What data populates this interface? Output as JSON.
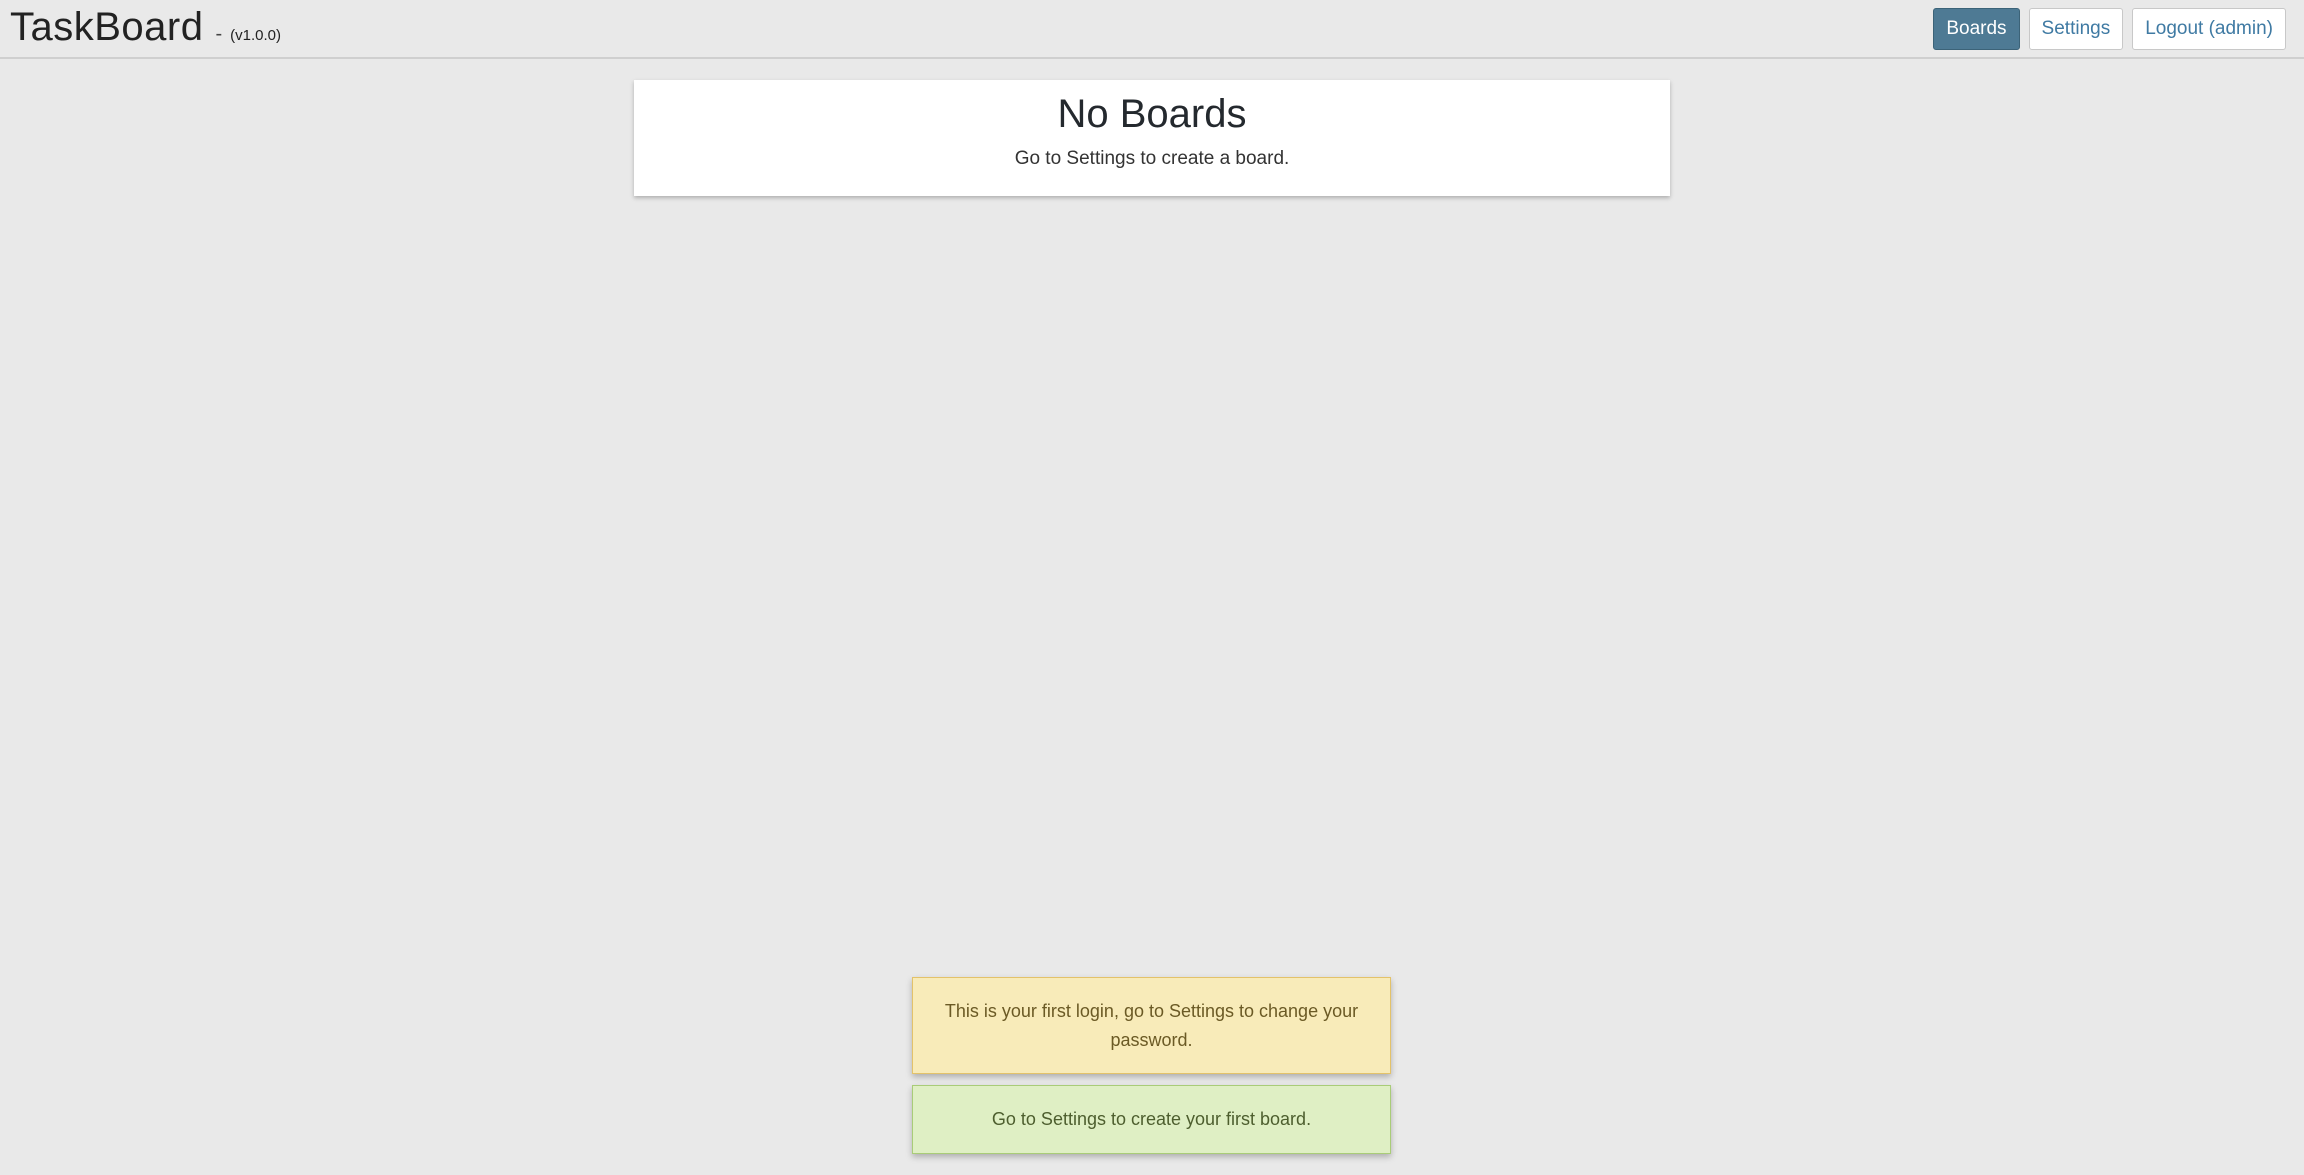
{
  "header": {
    "title": "TaskBoard",
    "separator": "-",
    "version": "(v1.0.0)",
    "nav": {
      "boards": "Boards",
      "settings": "Settings",
      "logout": "Logout (admin)"
    },
    "active_tab": "Boards"
  },
  "main": {
    "empty_title": "No Boards",
    "empty_message": "Go to Settings to create a board."
  },
  "notices": {
    "first_login": "This is your first login, go to Settings to change your password.",
    "first_board": "Go to Settings to create your first board."
  },
  "colors": {
    "accent": "#4e7a94",
    "link": "#3f7aa3",
    "warning_bg": "#f8ebb9",
    "success_bg": "#dfefc4",
    "page_bg": "#e9e9e9"
  }
}
